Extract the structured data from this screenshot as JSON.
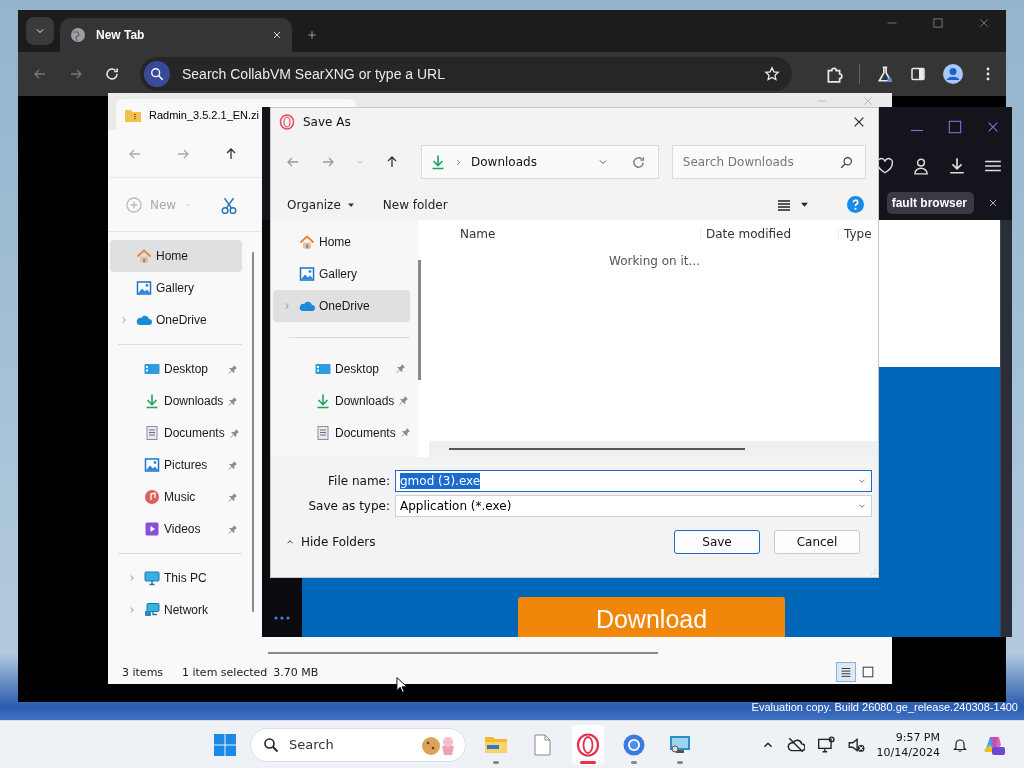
{
  "chrome": {
    "tabs": [
      {
        "label": "New Tab",
        "selected": true
      }
    ],
    "address_placeholder": "Search CollabVM SearXNG or type a URL"
  },
  "explorer": {
    "title": "Radmin_3.5.2.1_EN.zi",
    "new_label": "New",
    "nav_groups": [
      {
        "items": [
          {
            "label": "Home",
            "kind": "home",
            "selected": true,
            "expandable": false,
            "pinned": false
          },
          {
            "label": "Gallery",
            "kind": "gallery",
            "selected": false,
            "expandable": false,
            "pinned": false
          },
          {
            "label": "OneDrive",
            "kind": "cloud",
            "selected": false,
            "expandable": true,
            "pinned": false
          }
        ]
      },
      {
        "items": [
          {
            "label": "Desktop",
            "kind": "desktop",
            "selected": false,
            "expandable": false,
            "pinned": true
          },
          {
            "label": "Downloads",
            "kind": "downloads",
            "selected": false,
            "expandable": false,
            "pinned": true
          },
          {
            "label": "Documents",
            "kind": "documents",
            "selected": false,
            "expandable": false,
            "pinned": true
          },
          {
            "label": "Pictures",
            "kind": "gallery",
            "selected": false,
            "expandable": false,
            "pinned": true
          },
          {
            "label": "Music",
            "kind": "music",
            "selected": false,
            "expandable": false,
            "pinned": true
          },
          {
            "label": "Videos",
            "kind": "videos",
            "selected": false,
            "expandable": false,
            "pinned": true
          }
        ]
      },
      {
        "items": [
          {
            "label": "This PC",
            "kind": "monitor",
            "selected": false,
            "expandable": true,
            "pinned": false
          },
          {
            "label": "Network",
            "kind": "network",
            "selected": false,
            "expandable": true,
            "pinned": false
          }
        ]
      }
    ],
    "status": {
      "count": "3 items",
      "selection": "1 item selected",
      "size": "3.70 MB"
    },
    "views": [
      {
        "kind": "details",
        "selected": true
      },
      {
        "kind": "tiles",
        "selected": false
      }
    ]
  },
  "opera": {
    "banner": "fault browser",
    "download": "Download"
  },
  "dialog": {
    "title": "Save As",
    "path": "Downloads",
    "search_placeholder": "Search Downloads",
    "organize": "Organize",
    "new_folder": "New folder",
    "nav_groups": [
      {
        "items": [
          {
            "label": "Home",
            "kind": "home",
            "selected": false,
            "expandable": false,
            "pinned": false
          },
          {
            "label": "Gallery",
            "kind": "gallery",
            "selected": false,
            "expandable": false,
            "pinned": false
          },
          {
            "label": "OneDrive",
            "kind": "cloud",
            "selected": true,
            "expandable": true,
            "pinned": false
          }
        ]
      },
      {
        "items": [
          {
            "label": "Desktop",
            "kind": "desktop",
            "selected": false,
            "expandable": false,
            "pinned": true
          },
          {
            "label": "Downloads",
            "kind": "downloads",
            "selected": false,
            "expandable": false,
            "pinned": true
          },
          {
            "label": "Documents",
            "kind": "documents",
            "selected": false,
            "expandable": false,
            "pinned": true
          }
        ]
      }
    ],
    "columns": [
      "Name",
      "Date modified",
      "Type"
    ],
    "message": "Working on it...",
    "fields": [
      {
        "label": "File name:",
        "value": "gmod (3).exe",
        "text_selected": true
      },
      {
        "label": "Save as type:",
        "value": "Application (*.exe)",
        "text_selected": false
      }
    ],
    "hide_folders": "Hide Folders",
    "buttons": [
      {
        "label": "Save",
        "default": true
      },
      {
        "label": "Cancel",
        "default": false
      }
    ]
  },
  "desktop": {
    "watermark": "Evaluation copy. Build 26080.ge_release.240308-1400"
  },
  "taskbar": {
    "search_placeholder": "Search",
    "apps": [
      {
        "kind": "folder",
        "running": true,
        "active": false
      },
      {
        "kind": "notepad",
        "running": false,
        "active": false
      },
      {
        "kind": "opera",
        "running": true,
        "active": true
      },
      {
        "kind": "chrome",
        "running": true,
        "active": false
      },
      {
        "kind": "remote",
        "running": true,
        "active": false
      }
    ],
    "time": "9:57 PM",
    "date": "10/14/2024"
  }
}
